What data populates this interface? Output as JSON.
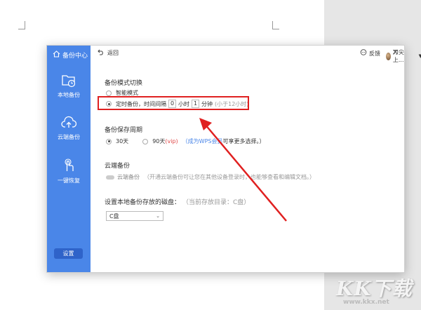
{
  "sidebar": {
    "header": "备份中心",
    "items": [
      {
        "label": "本地备份",
        "icon": "folder-clock-icon"
      },
      {
        "label": "云端备份",
        "icon": "cloud-upload-icon"
      },
      {
        "label": "一键恢复",
        "icon": "hand-tap-icon"
      }
    ],
    "settings_label": "设置",
    "accent": "#4a86e8"
  },
  "topbar": {
    "back_label": "返回",
    "feedback_label": "反馈",
    "user_name": "刀尖上...",
    "close_glyph": "✕"
  },
  "backup_mode": {
    "title": "备份模式切换",
    "option_smart": "智能模式",
    "option_timed_prefix": "定时备份，时间间隔",
    "hours_value": "0",
    "hours_unit": "小时",
    "minutes_value": "1",
    "minutes_unit": "分钟",
    "hint": "(小于12小时)",
    "selected": "timed"
  },
  "retention": {
    "title": "备份保存周期",
    "option_30": "30天",
    "option_90": "90天",
    "vip_tag": "(vip)",
    "note_prefix": "（",
    "note_link": "成为WPS会员",
    "note_suffix": "可享更多选择。）",
    "selected": "30"
  },
  "cloud": {
    "title": "云端备份",
    "toggle_label": "云端备份",
    "desc": "（开通云端备份可让您在其他设备登录时，也能够查看和编辑文档。）"
  },
  "disk": {
    "title": "设置本地备份存放的磁盘：",
    "current": "（当前存放目录：C盘）",
    "selected_value": "C盘"
  },
  "watermark": {
    "brand": "KK下载",
    "url": "www.kkx.net"
  }
}
